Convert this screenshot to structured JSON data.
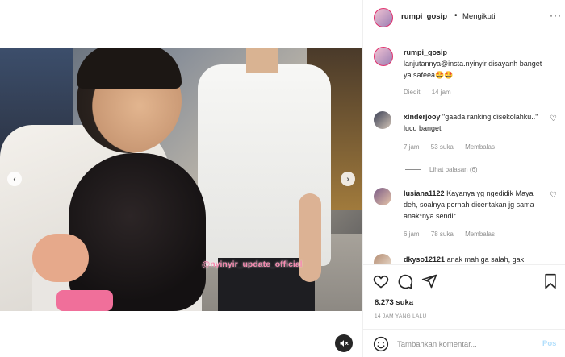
{
  "post": {
    "username": "rumpi_gosip",
    "follow_status": "Mengikuti",
    "separator": "•",
    "more": "···"
  },
  "media": {
    "watermark": "@nyinyir_update_official",
    "prev": "‹",
    "next": "›"
  },
  "caption": {
    "username": "rumpi_gosip",
    "text": "lanjutannya@insta.nyinyir disayanh banget ya safeea🤩🤩",
    "edited": "Diedit",
    "age": "14 jam"
  },
  "comments": [
    {
      "username": "xinderjooy",
      "text": "\"gaada ranking disekolahku..\" lucu banget",
      "age": "7 jam",
      "likes": "53 suka",
      "reply": "Membalas",
      "view_replies": "Lihat balasan (6)"
    },
    {
      "username": "lusiana1122",
      "text": "Kayanya yg ngedidik Maya deh, soalnya pernah diceritakan jg sama anak*nya sendir",
      "age": "6 jam",
      "likes": "78 suka",
      "reply": "Membalas"
    },
    {
      "username": "dkyso12121",
      "text": "anak mah ga salah, gak"
    }
  ],
  "stats": {
    "likes": "8.273 suka",
    "time": "14 JAM YANG LALU"
  },
  "composer": {
    "placeholder": "Tambahkan komentar...",
    "post": "Pos"
  },
  "icons": {
    "header_avatar": "avatar-icon",
    "heart": "heart-icon",
    "comment": "comment-icon",
    "share": "share-icon",
    "save": "bookmark-icon",
    "emoji": "emoji-icon",
    "mute": "mute-icon"
  },
  "colors": {
    "text": "#262626",
    "muted": "#8e8e8e",
    "border": "#efefef",
    "post_button": "#b2dffc",
    "watermark": "#f58ab0"
  }
}
